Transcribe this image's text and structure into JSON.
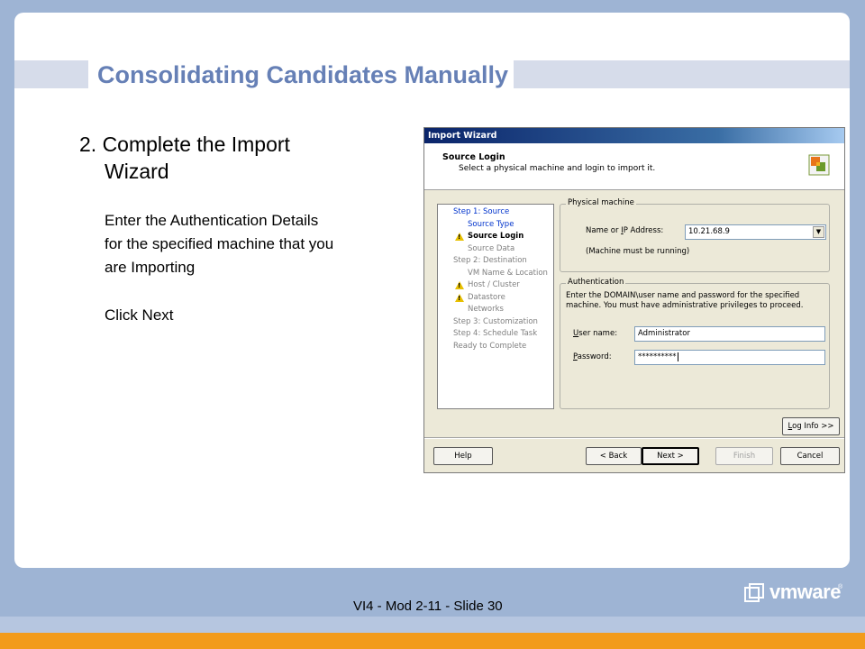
{
  "slide": {
    "title": "Consolidating Candidates Manually",
    "step_heading_line1": "2. Complete the Import",
    "step_heading_line2": "Wizard",
    "instruction_line1": "Enter the Authentication Details",
    "instruction_line2": "for the specified machine that you",
    "instruction_line3": "are Importing",
    "click_next": "Click Next",
    "footer": "VI4 - Mod 2-11 - Slide   30",
    "brand": "vmware",
    "brand_mark": "®"
  },
  "wizard": {
    "title": "Import Wizard",
    "header_title": "Source Login",
    "header_subtitle": "Select a physical machine and login to import it.",
    "nav": [
      {
        "label": "Step 1: Source",
        "state": "link",
        "indent": 0,
        "warn": false
      },
      {
        "label": "Source Type",
        "state": "link",
        "indent": 1,
        "warn": false
      },
      {
        "label": "Source Login",
        "state": "active",
        "indent": 1,
        "warn": true
      },
      {
        "label": "Source Data",
        "state": "dim",
        "indent": 1,
        "warn": false
      },
      {
        "label": "Step 2: Destination",
        "state": "dim",
        "indent": 0,
        "warn": false
      },
      {
        "label": "VM Name & Location",
        "state": "dim",
        "indent": 1,
        "warn": false
      },
      {
        "label": "Host / Cluster",
        "state": "dim",
        "indent": 1,
        "warn": true
      },
      {
        "label": "Datastore",
        "state": "dim",
        "indent": 1,
        "warn": true
      },
      {
        "label": "Networks",
        "state": "dim",
        "indent": 1,
        "warn": false
      },
      {
        "label": "Step 3: Customization",
        "state": "dim",
        "indent": 0,
        "warn": false
      },
      {
        "label": "Step 4: Schedule Task",
        "state": "dim",
        "indent": 0,
        "warn": false
      },
      {
        "label": "Ready to Complete",
        "state": "dim",
        "indent": 0,
        "warn": false
      }
    ],
    "physical_group_label": "Physical machine",
    "ip_label_pre": "Name or ",
    "ip_label_accel": "I",
    "ip_label_post": "P Address:",
    "ip_value": "10.21.68.9",
    "machine_note": "(Machine must be running)",
    "auth_group_label": "Authentication",
    "auth_desc_line1": "Enter the DOMAIN\\user name and password for the specified",
    "auth_desc_line2": "machine. You must have administrative privileges to proceed.",
    "user_label_accel": "U",
    "user_label_post": "ser name:",
    "user_value": "Administrator",
    "pass_label_accel": "P",
    "pass_label_post": "assword:",
    "pass_value": "**********",
    "log_info": "Log Info >>",
    "help": "Help",
    "back": "< Back",
    "next": "Next >",
    "finish": "Finish",
    "cancel": "Cancel"
  },
  "colors": {
    "title": "#6680b6",
    "background": "#9eb4d4",
    "orange_band": "#f29b1c",
    "link": "#0033cc"
  }
}
